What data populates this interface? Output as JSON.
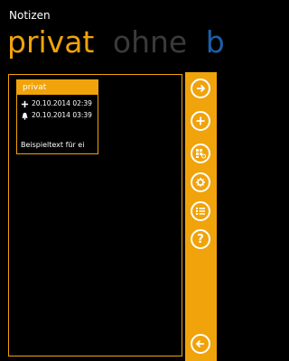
{
  "app": {
    "title": "Notizen"
  },
  "pivot": {
    "items": [
      "privat",
      "ohne",
      "be"
    ]
  },
  "note": {
    "title": "privat",
    "created": "20.10.2014 02:39",
    "reminder": "20.10.2014 03:39",
    "text": "Beispieltext für ei"
  },
  "sidebar": {
    "buttons": [
      {
        "icon": "arrow-right-icon"
      },
      {
        "icon": "plus-icon"
      },
      {
        "icon": "tiles-settings-icon"
      },
      {
        "icon": "gear-icon"
      },
      {
        "icon": "list-icon"
      },
      {
        "icon": "help-icon",
        "label": "?"
      },
      {
        "icon": "arrow-left-icon"
      }
    ]
  },
  "colors": {
    "accent": "#f0a30a",
    "inactive_pivot": "#3a3a3a",
    "peek_pivot": "#1b5fa8"
  }
}
